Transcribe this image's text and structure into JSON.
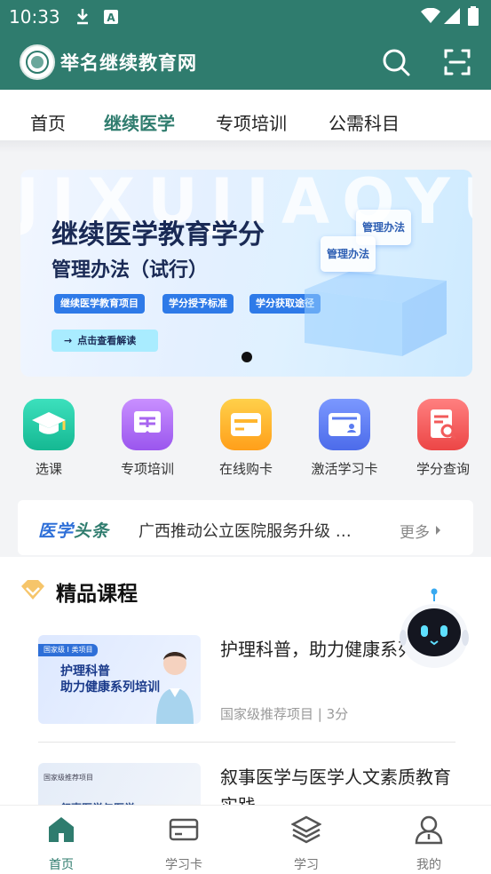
{
  "status_bar": {
    "time": "10:33"
  },
  "app_bar": {
    "title": "举名继续教育网"
  },
  "tabs": [
    {
      "label": "首页",
      "active": false
    },
    {
      "label": "继续医学",
      "active": true
    },
    {
      "label": "专项培训",
      "active": false
    },
    {
      "label": "公需科目",
      "active": false
    }
  ],
  "banner": {
    "watermark": "JIXUJIAOYU",
    "title_line1": "继续医学教育学分",
    "title_line2": "管理办法（试行）",
    "chips": [
      "继续医学教育项目",
      "学分授予标准",
      "学分获取途径"
    ],
    "cta": "点击查看解读",
    "card_labels": [
      "管理办法",
      "管理办法"
    ]
  },
  "quick_actions": [
    {
      "label": "选课",
      "icon": "graduation-cap-icon",
      "color": "#20c5a2"
    },
    {
      "label": "专项培训",
      "icon": "training-icon",
      "color": "#b06ef0"
    },
    {
      "label": "在线购卡",
      "icon": "card-icon",
      "color": "#ffb62e"
    },
    {
      "label": "激活学习卡",
      "icon": "id-card-icon",
      "color": "#5b7cf0"
    },
    {
      "label": "学分查询",
      "icon": "search-document-icon",
      "color": "#f25a5a"
    }
  ],
  "headline": {
    "brand_part1": "医学",
    "brand_part2": "头条",
    "news": "广西推动公立医院服务升级 …",
    "more": "更多"
  },
  "section": {
    "title": "精品课程"
  },
  "courses": [
    {
      "title": "护理科普，助力健康系列培训",
      "meta": "国家级推荐项目 | 3分",
      "thumb_tag": "国家级 I 类项目",
      "thumb_line1": "护理科普",
      "thumb_line2": "助力健康系列培训"
    },
    {
      "title": "叙事医学与医学人文素质教育实践",
      "meta": "",
      "thumb_tag": "国家级推荐项目",
      "thumb_line1": "叙事医学与医学",
      "thumb_line2": ""
    }
  ],
  "bottom_nav": [
    {
      "label": "首页",
      "active": true
    },
    {
      "label": "学习卡",
      "active": false
    },
    {
      "label": "学习",
      "active": false
    },
    {
      "label": "我的",
      "active": false
    }
  ],
  "colors": {
    "primary": "#2f7c6e",
    "accent_blue": "#2e6fd8"
  }
}
